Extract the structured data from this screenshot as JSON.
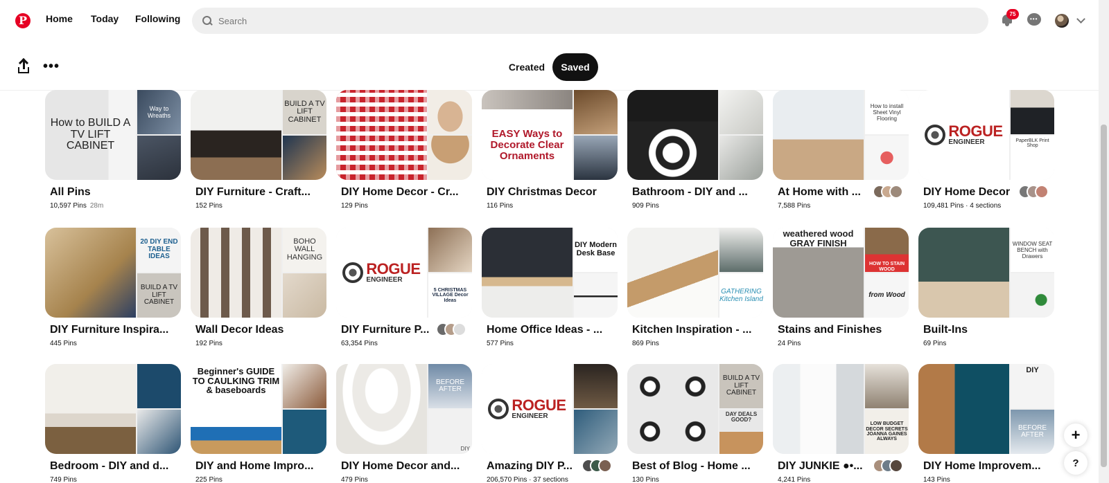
{
  "header": {
    "logo_letter": "P",
    "nav": [
      "Home",
      "Today",
      "Following"
    ],
    "search_placeholder": "Search",
    "notification_count": "75"
  },
  "profile_tabs": {
    "created": "Created",
    "saved": "Saved",
    "more": "•••"
  },
  "boards": [
    {
      "title": "All Pins",
      "pins": "10,597 Pins",
      "time": "28m",
      "covers": [
        "How to BUILD A TV LIFT CABINET",
        "Way to Wreaths",
        ""
      ]
    },
    {
      "title": "DIY Furniture - Craft...",
      "pins": "152 Pins",
      "covers": [
        "",
        "BUILD A TV LIFT CABINET",
        ""
      ]
    },
    {
      "title": "DIY Home Decor - Cr...",
      "pins": "129 Pins",
      "covers": [
        "",
        "",
        ""
      ]
    },
    {
      "title": "DIY Christmas Decor",
      "pins": "116 Pins",
      "covers": [
        "EASY Ways to Decorate Clear Ornaments",
        "",
        ""
      ]
    },
    {
      "title": "Bathroom - DIY and ...",
      "pins": "909 Pins",
      "covers": [
        "",
        "",
        ""
      ]
    },
    {
      "title": "At Home with ...",
      "pins": "7,588 Pins",
      "covers": [
        "",
        "How to install Sheet Vinyl Flooring",
        ""
      ]
    },
    {
      "title": "DIY Home Decor",
      "pins": "109,481 Pins · 4 sections",
      "covers": [
        "ROGUE ENGINEER",
        "",
        "PaperBLK Print Shop"
      ]
    },
    {
      "title": "DIY Furniture Inspira...",
      "pins": "445 Pins",
      "covers": [
        "",
        "20 DIY END TABLE IDEAS",
        "BUILD A TV LIFT CABINET"
      ]
    },
    {
      "title": "Wall Decor Ideas",
      "pins": "192 Pins",
      "covers": [
        "",
        "BOHO WALL HANGING",
        ""
      ]
    },
    {
      "title": "DIY Furniture P...",
      "pins": "63,354 Pins",
      "covers": [
        "ROGUE ENGINEER",
        "",
        "5 CHRISTMAS VILLAGE Decor Ideas"
      ]
    },
    {
      "title": "Home Office Ideas - ...",
      "pins": "577 Pins",
      "covers": [
        "",
        "DIY Modern Desk Base",
        ""
      ]
    },
    {
      "title": "Kitchen Inspiration - ...",
      "pins": "869 Pins",
      "covers": [
        "",
        "",
        "GATHERING Kitchen Island"
      ]
    },
    {
      "title": "Stains and Finishes",
      "pins": "24 Pins",
      "covers": [
        "weathered wood GRAY FINISH",
        "HOW TO STAIN WOOD",
        "from Wood"
      ]
    },
    {
      "title": "Built-Ins",
      "pins": "69 Pins",
      "covers": [
        "",
        "WINDOW SEAT BENCH with Drawers",
        ""
      ]
    },
    {
      "title": "Bedroom - DIY and d...",
      "pins": "749 Pins",
      "covers": [
        "",
        "",
        ""
      ]
    },
    {
      "title": "DIY and Home Impro...",
      "pins": "225 Pins",
      "covers": [
        "Beginner's GUIDE TO CAULKING TRIM & baseboards",
        "",
        ""
      ]
    },
    {
      "title": "DIY Home Decor and...",
      "pins": "479 Pins",
      "covers": [
        "",
        "BEFORE AFTER",
        "DIY"
      ]
    },
    {
      "title": "Amazing DIY P...",
      "pins": "206,570 Pins · 37 sections",
      "covers": [
        "ROGUE ENGINEER",
        "",
        ""
      ]
    },
    {
      "title": "Best of Blog - Home ...",
      "pins": "130 Pins",
      "covers": [
        "",
        "BUILD A TV LIFT CABINET",
        "DAY DEALS GOOD?"
      ]
    },
    {
      "title": "DIY JUNKIE ●•...",
      "pins": "4,241 Pins",
      "covers": [
        "",
        "",
        "LOW BUDGET DECOR SECRETS JOANNA GAINES ALWAYS"
      ]
    },
    {
      "title": "DIY Home Improvem...",
      "pins": "143 Pins",
      "covers": [
        "",
        "DIY",
        "BEFORE AFTER"
      ]
    }
  ],
  "fab": {
    "plus": "+",
    "help": "?"
  },
  "colors": {
    "brand": "#e60023",
    "saved_tab": "#111111",
    "search_bg": "#efefef"
  }
}
